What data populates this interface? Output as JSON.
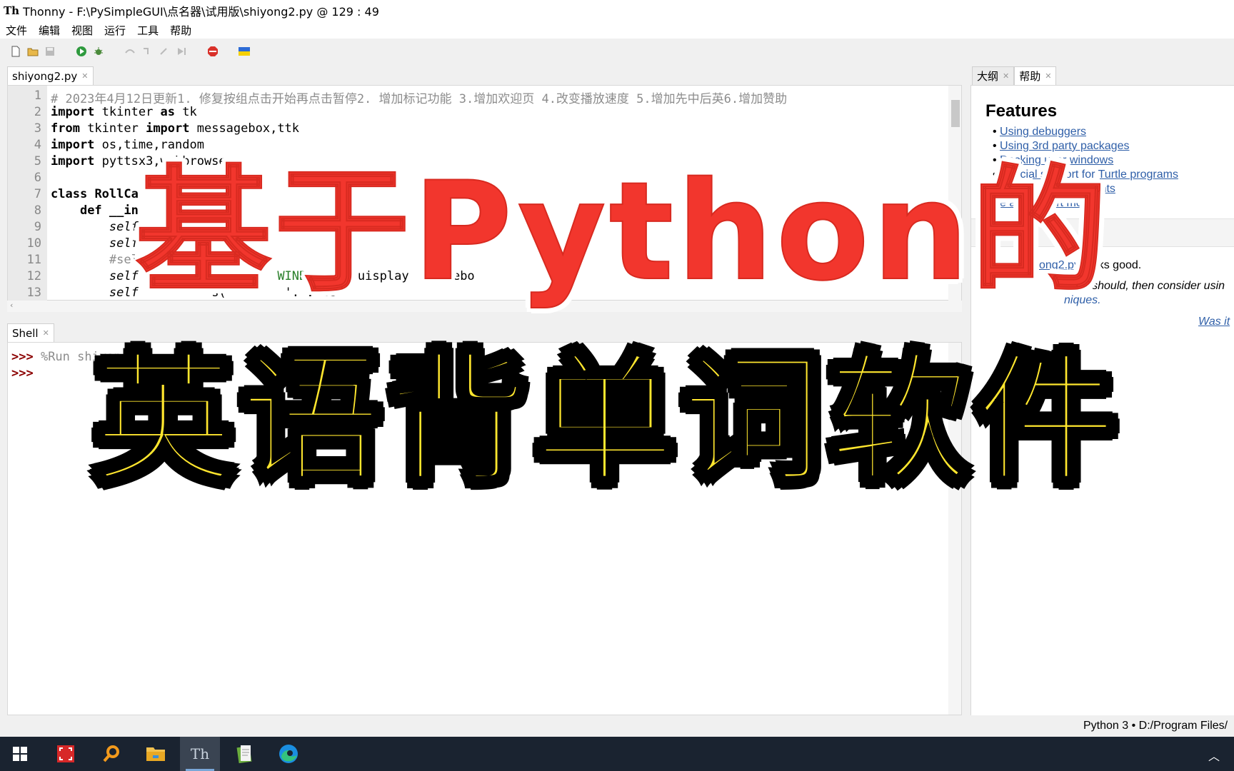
{
  "window": {
    "title": "Thonny  -  F:\\PySimpleGUI\\点名器\\试用版\\shiyong2.py  @  129 : 49"
  },
  "menu": [
    "文件",
    "编辑",
    "视图",
    "运行",
    "工具",
    "帮助"
  ],
  "editor": {
    "tab_label": "shiyong2.py",
    "line_numbers": [
      "1",
      "2",
      "3",
      "4",
      "5",
      "6",
      "7",
      "8",
      "9",
      "10",
      "11",
      "12",
      "13"
    ]
  },
  "shell": {
    "tab_label": "Shell",
    "prompt": ">>>",
    "command": " %Run shiyon"
  },
  "right_panel": {
    "tabs": [
      "大纲",
      "帮助"
    ],
    "features_title": "Features",
    "features": [
      "Using debuggers",
      "Using 3rd party packages",
      "Docking user windows",
      "Special support for Turtle programs",
      "ng program arguments",
      "e and expert mode"
    ],
    "message_link": "ong2.py",
    "message_text": " looks good.",
    "italic_line_1": "g as it should, then consider usin",
    "italic_line_2": "niques.",
    "was_it": "Was it"
  },
  "status": {
    "text": "Python 3  •  D:/Program Files/"
  },
  "overlay": {
    "line1": "基于Python的",
    "line2": "英语背单词软件"
  },
  "colors": {
    "overlay_red": "#f2362d",
    "overlay_yellow": "#ffe62e",
    "link": "#2f5fa8"
  },
  "taskbar_icons": [
    "windows-start-icon",
    "snip-tool-icon",
    "search-icon",
    "file-explorer-icon",
    "thonny-icon",
    "notepad-icon",
    "edge-browser-icon"
  ]
}
